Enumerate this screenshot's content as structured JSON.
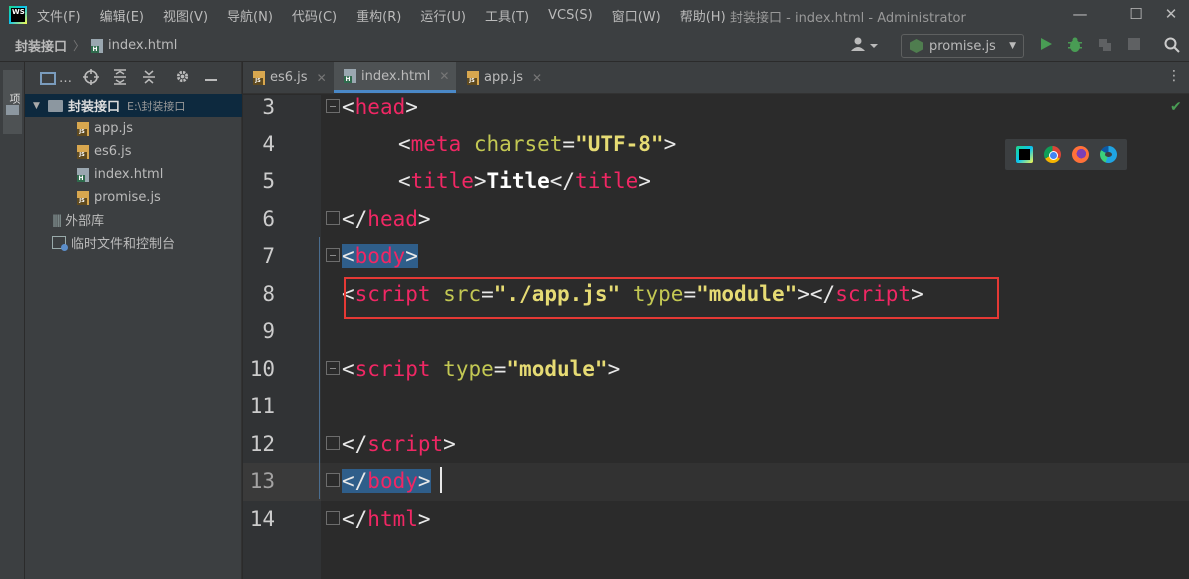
{
  "app": {
    "logo_text": "WS",
    "menu": [
      "文件(F)",
      "编辑(E)",
      "视图(V)",
      "导航(N)",
      "代码(C)",
      "重构(R)",
      "运行(U)",
      "工具(T)",
      "VCS(S)",
      "窗口(W)",
      "帮助(H)"
    ],
    "window_title": "封装接口 - index.html - Administrator",
    "controls": {
      "minimize": "—",
      "maximize": "☐",
      "close": "✕"
    }
  },
  "navbar": {
    "breadcrumb_project": "封装接口",
    "breadcrumb_separator": "〉",
    "breadcrumb_file": "index.html",
    "user_icon": "user-icon",
    "run_config": "promise.js",
    "run_config_caret": "▼"
  },
  "toolstrip": {
    "project_tab": "项目"
  },
  "project_panel": {
    "view_label": "…",
    "tree": {
      "root_label": "封装接口",
      "root_path": "E:\\封装接口",
      "files": [
        "app.js",
        "es6.js",
        "index.html",
        "promise.js"
      ],
      "external_libs": "外部库",
      "scratches": "临时文件和控制台"
    }
  },
  "tabs": [
    {
      "label": "es6.js",
      "type": "js",
      "active": false
    },
    {
      "label": "index.html",
      "type": "html",
      "active": true
    },
    {
      "label": "app.js",
      "type": "js",
      "active": false
    }
  ],
  "tabs_menu": "⋮",
  "editor": {
    "line_numbers": [
      "3",
      "4",
      "5",
      "6",
      "7",
      "8",
      "9",
      "10",
      "11",
      "12",
      "13",
      "14"
    ],
    "current_line": "13",
    "code": {
      "l3": {
        "lt": "<",
        "tag": "head",
        "gt": ">"
      },
      "l4": {
        "lt": "<",
        "tag": "meta",
        "attr": "charset",
        "eq": "=",
        "val": "\"UTF-8\"",
        "gt": ">"
      },
      "l5": {
        "lt": "<",
        "tag": "title",
        "gt": ">",
        "text": "Title",
        "lt2": "</",
        "tag2": "title",
        "gt2": ">"
      },
      "l6": {
        "lt": "</",
        "tag": "head",
        "gt": ">"
      },
      "l7": {
        "lt": "<",
        "tag": "body",
        "gt": ">"
      },
      "l8": {
        "lt": "<",
        "tag": "script",
        "attr": "src",
        "eq": "=",
        "val": "\"./app.js\"",
        "attr2": "type",
        "eq2": "=",
        "val2": "\"module\"",
        "gt": ">",
        "lt2": "</",
        "tag2": "script",
        "gt2": ">"
      },
      "l10": {
        "lt": "<",
        "tag": "script",
        "attr": "type",
        "eq": "=",
        "val": "\"module\"",
        "gt": ">"
      },
      "l12": {
        "lt": "</",
        "tag": "script",
        "gt": ">"
      },
      "l13": {
        "lt": "</",
        "tag": "body",
        "gt": ">"
      },
      "l14": {
        "lt": "</",
        "tag": "html",
        "gt": ">"
      }
    },
    "browser_icons": [
      "webstorm-icon",
      "chrome-icon",
      "firefox-icon",
      "edge-icon"
    ],
    "inspection_status": "✔"
  },
  "colors": {
    "tag": "#f02764",
    "attr": "#c3c853",
    "value": "#e6db74",
    "selection": "#2f5e8a",
    "highlight_box": "#e53935",
    "tab_active_underline": "#4a88c7"
  }
}
